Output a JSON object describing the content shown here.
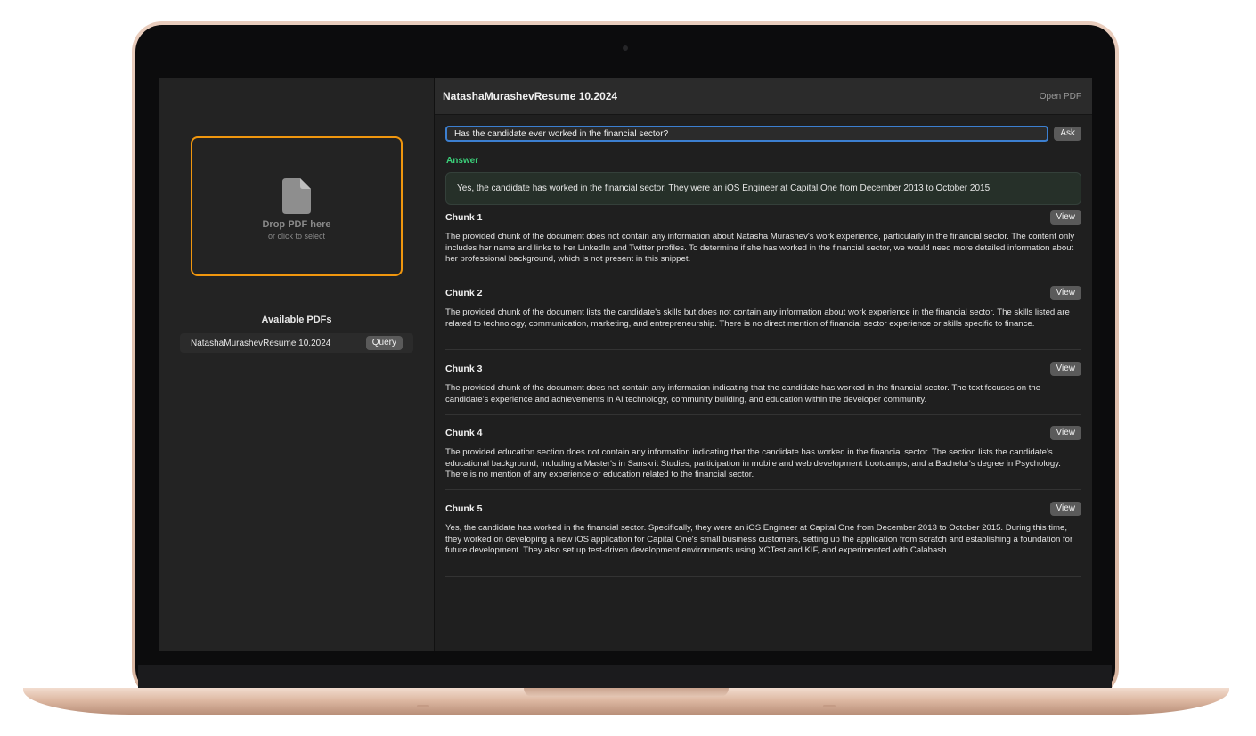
{
  "sidebar": {
    "dropzone": {
      "title": "Drop PDF here",
      "subtitle": "or click to select"
    },
    "available_title": "Available PDFs",
    "pdfs": [
      {
        "name": "NatashaMurashevResume 10.2024",
        "action": "Query"
      }
    ]
  },
  "header": {
    "title": "NatashaMurashevResume 10.2024",
    "open_pdf": "Open PDF"
  },
  "query": {
    "value": "Has the candidate ever worked in the financial sector?",
    "ask_label": "Ask"
  },
  "answer": {
    "label": "Answer",
    "text": "Yes, the candidate has worked in the financial sector. They were an iOS Engineer at Capital One from December 2013 to October 2015."
  },
  "chunks": [
    {
      "title": "Chunk 1",
      "view": "View",
      "text": "The provided chunk of the document does not contain any information about Natasha Murashev's work experience, particularly in the financial sector. The content only includes her name and links to her LinkedIn and Twitter profiles. To determine if she has worked in the financial sector, we would need more detailed information about her professional background, which is not present in this snippet."
    },
    {
      "title": "Chunk 2",
      "view": "View",
      "text": "The provided chunk of the document lists the candidate's skills but does not contain any information about work experience in the financial sector. The skills listed are related to technology, communication, marketing, and entrepreneurship. There is no direct mention of financial sector experience or skills specific to finance."
    },
    {
      "title": "Chunk 3",
      "view": "View",
      "text": "The provided chunk of the document does not contain any information indicating that the candidate has worked in the financial sector. The text focuses on the candidate's experience and achievements in AI technology, community building, and education within the developer community."
    },
    {
      "title": "Chunk 4",
      "view": "View",
      "text": "The provided education section does not contain any information indicating that the candidate has worked in the financial sector. The section lists the candidate's educational background, including a Master's in Sanskrit Studies, participation in mobile and web development bootcamps, and a Bachelor's degree in Psychology. There is no mention of any experience or education related to the financial sector."
    },
    {
      "title": "Chunk 5",
      "view": "View",
      "text": "Yes, the candidate has worked in the financial sector. Specifically, they were an iOS Engineer at Capital One from December 2013 to October 2015. During this time, they worked on developing a new iOS application for Capital One's small business customers, setting up the application from scratch and establishing a foundation for future development. They also set up test-driven development environments using XCTest and KIF, and experimented with Calabash."
    }
  ]
}
